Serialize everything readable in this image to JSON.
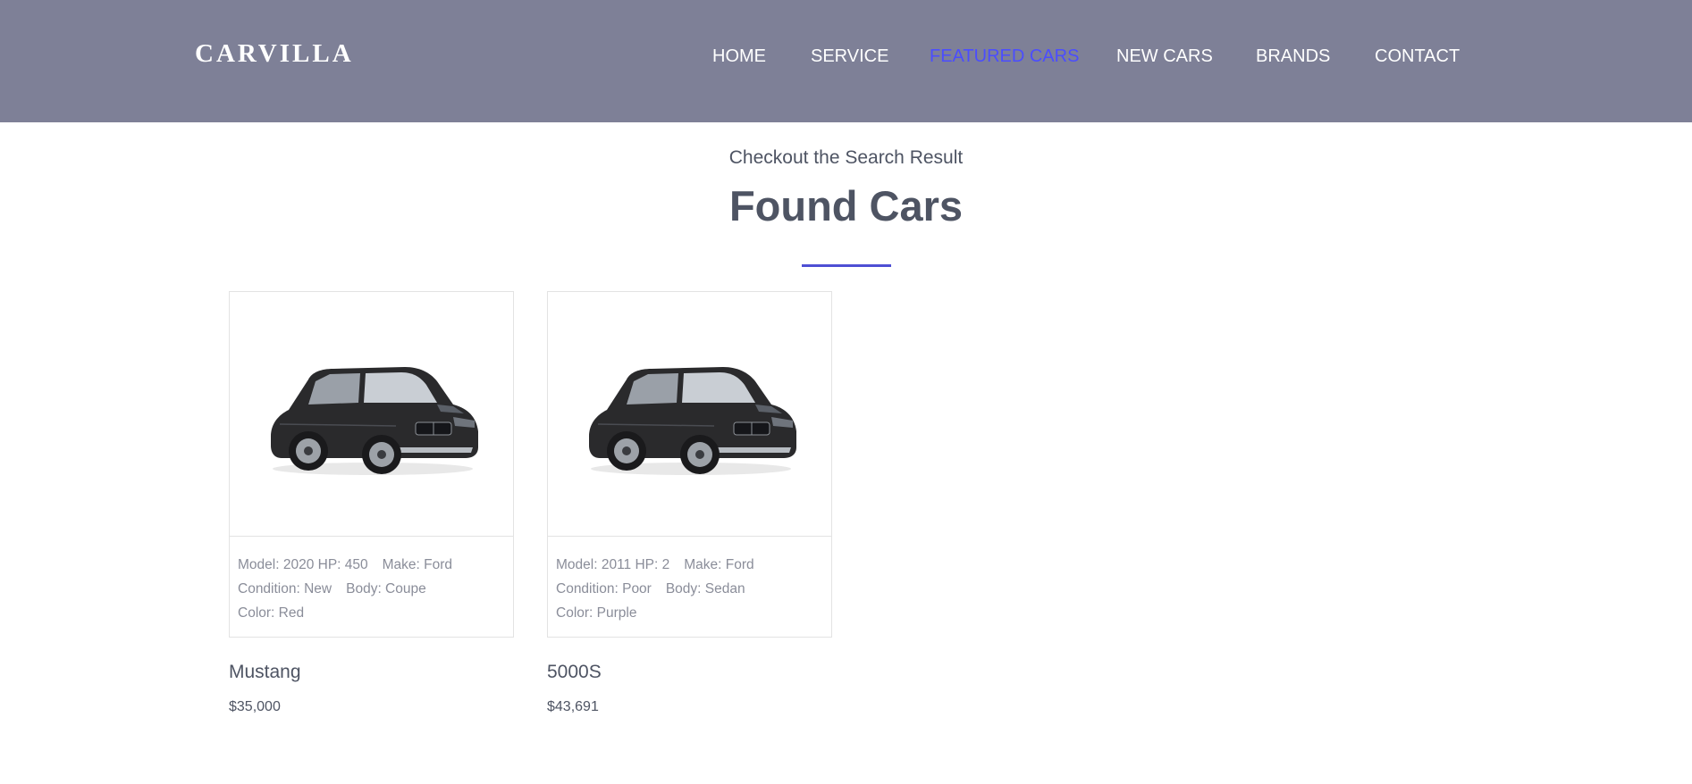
{
  "brand": {
    "logo": "CARVILLA"
  },
  "nav": {
    "items": [
      {
        "label": "HOME",
        "active": false
      },
      {
        "label": "SERVICE",
        "active": false
      },
      {
        "label": "FEATURED CARS",
        "active": true
      },
      {
        "label": "NEW CARS",
        "active": false
      },
      {
        "label": "BRANDS",
        "active": false
      },
      {
        "label": "CONTACT",
        "active": false
      }
    ],
    "active_color": "#4b4dff"
  },
  "section": {
    "subtitle": "Checkout the Search Result",
    "title": "Found Cars"
  },
  "cars": [
    {
      "image_icon": "car-image",
      "model": "Model: 2020",
      "hp": "HP: 450",
      "make": "Make: Ford",
      "condition": "Condition: New",
      "body": "Body: Coupe",
      "color": "Color: Red",
      "name": "Mustang",
      "price": "$35,000"
    },
    {
      "image_icon": "car-image",
      "model": "Model: 2011",
      "hp": "HP: 2",
      "make": "Make: Ford",
      "condition": "Condition: Poor",
      "body": "Body: Sedan",
      "color": "Color: Purple",
      "name": "5000S",
      "price": "$43,691"
    }
  ],
  "colors": {
    "header_bg": "#7e8097",
    "accent": "#4e4fd4",
    "text": "#4e5463",
    "muted": "#8a8d99"
  }
}
